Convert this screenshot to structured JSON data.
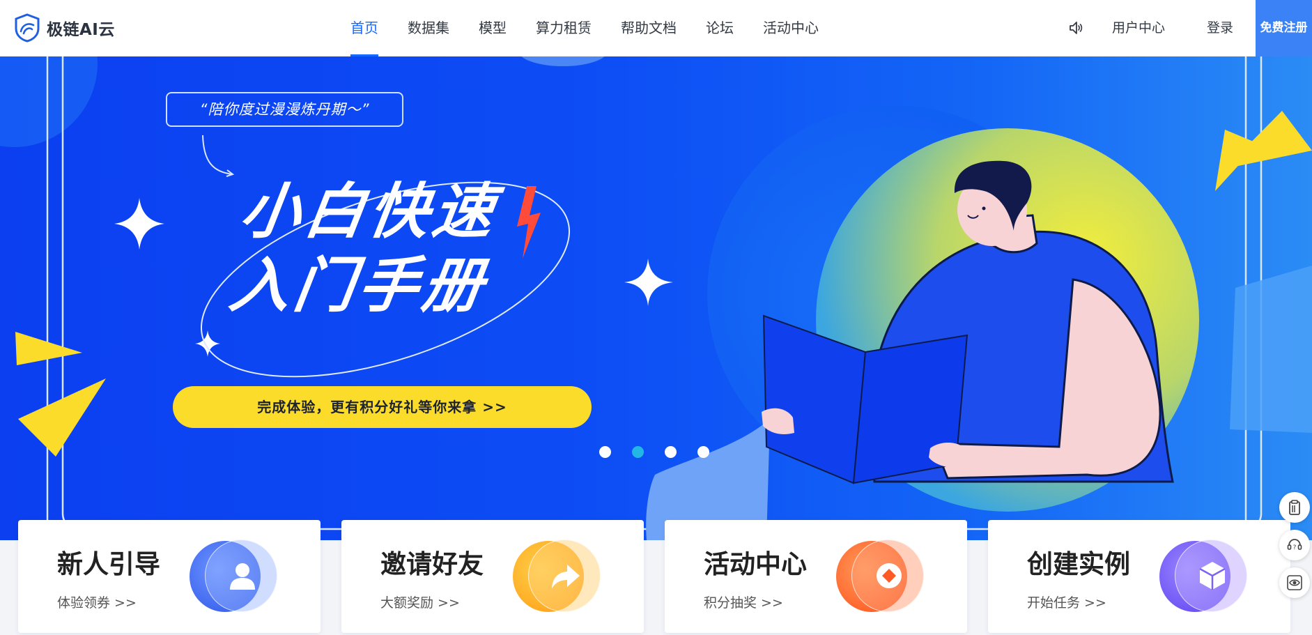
{
  "header": {
    "logo_text": "极链AI云",
    "nav": [
      "首页",
      "数据集",
      "模型",
      "算力租赁",
      "帮助文档",
      "论坛",
      "活动中心"
    ],
    "user_center": "用户中心",
    "login": "登录",
    "register": "免费注册"
  },
  "banner": {
    "quote": "“陪你度过漫漫炼丹期～”",
    "headline_line1": "小白快速",
    "headline_line2": "入门手册",
    "cta": "完成体验，更有积分好礼等你来拿 >>",
    "slide_count": 4,
    "active_slide": 2
  },
  "cards": [
    {
      "title": "新人引导",
      "sub": "体验领券 >>",
      "icon": "user-icon",
      "color": "#3b6cf0"
    },
    {
      "title": "邀请好友",
      "sub": "大额奖励 >>",
      "icon": "share-arrow-icon",
      "color": "#ffa21a"
    },
    {
      "title": "活动中心",
      "sub": "积分抽奖 >>",
      "icon": "coin-icon",
      "color": "#ff5a26"
    },
    {
      "title": "创建实例",
      "sub": "开始任务 >>",
      "icon": "cube-icon",
      "color": "#6b55f0"
    }
  ],
  "side_tools": [
    "clipboard-icon",
    "support-icon",
    "eye-icon"
  ],
  "colors": {
    "primary": "#1668ff",
    "banner_blue": "#0d4df5",
    "cta_yellow": "#fcdc2a"
  }
}
